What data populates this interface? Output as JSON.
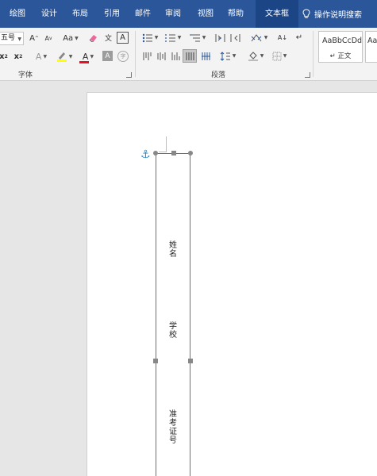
{
  "tabs": {
    "home": "绘图",
    "design": "设计",
    "layout": "布局",
    "references": "引用",
    "mailings": "邮件",
    "review": "审阅",
    "view": "视图",
    "help": "帮助",
    "textbox": "文本框"
  },
  "tell_me": "操作说明搜索",
  "ribbon": {
    "font": {
      "size_value": "五号",
      "grow": "A",
      "shrink": "A",
      "change_case": "Aa",
      "phonetic": "文",
      "char_border": "A",
      "subscript": "x",
      "superscript": "x",
      "text_effects": "A",
      "font_color": "A",
      "char_shading": "A",
      "enclose": "字",
      "group_label": "字体"
    },
    "paragraph": {
      "sort": "A↓",
      "show_marks": "↵",
      "group_label": "段落"
    },
    "styles": {
      "normal_sample": "AaBbCcDd",
      "normal_name": "正文",
      "next_sample": "AaBl"
    }
  },
  "colors": {
    "tab_bar": "#2b579a",
    "active_tab": "#1c4585",
    "highlight": "#ffff00",
    "font_color": "#e81123",
    "anchor": "#2a8dd4"
  },
  "textbox": {
    "label_name": "姓名",
    "label_school": "学校",
    "label_exam_id": "准考证号"
  }
}
